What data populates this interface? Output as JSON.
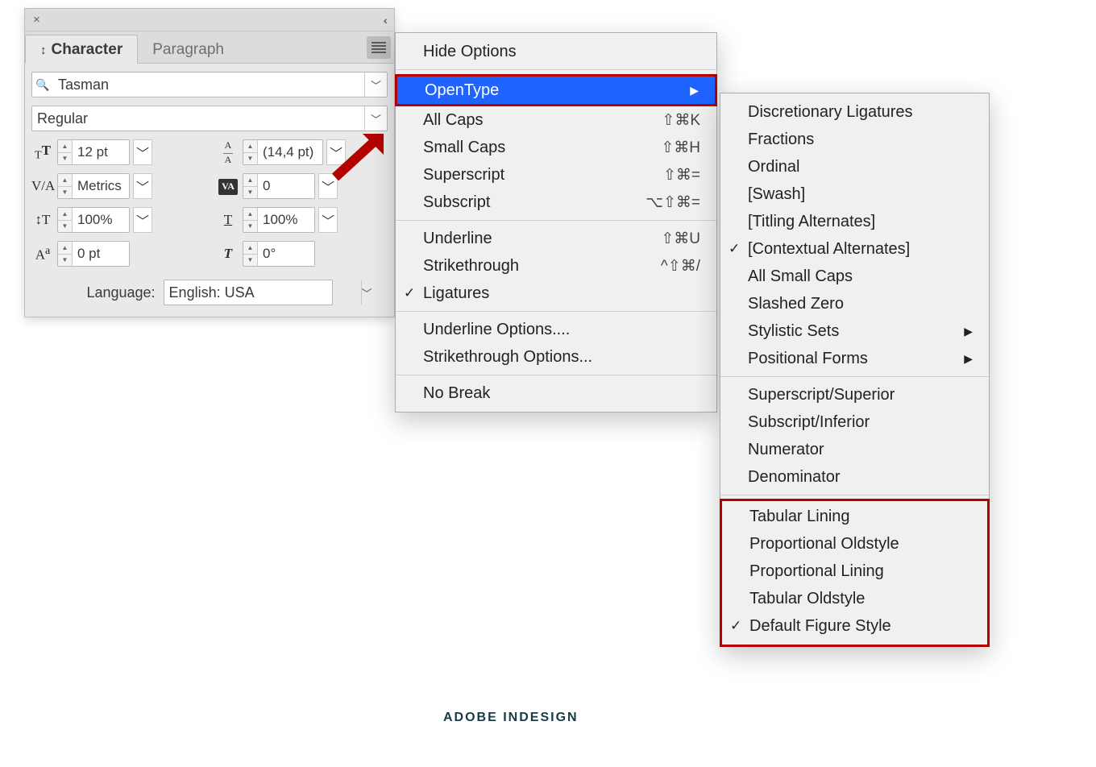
{
  "panel": {
    "tabs": {
      "character": "Character",
      "paragraph": "Paragraph"
    },
    "font_family": "Tasman",
    "font_style": "Regular",
    "font_size": "12 pt",
    "leading": "(14,4 pt)",
    "kerning": "Metrics",
    "tracking": "0",
    "vscale": "100%",
    "hscale": "100%",
    "baseline": "0 pt",
    "skew": "0°",
    "language_label": "Language:",
    "language_value": "English: USA"
  },
  "menu1": {
    "hide_options": "Hide Options",
    "opentype": "OpenType",
    "all_caps": {
      "label": "All Caps",
      "shortcut": "⇧⌘K"
    },
    "small_caps": {
      "label": "Small Caps",
      "shortcut": "⇧⌘H"
    },
    "superscript": {
      "label": "Superscript",
      "shortcut": "⇧⌘="
    },
    "subscript": {
      "label": "Subscript",
      "shortcut": "⌥⇧⌘="
    },
    "underline": {
      "label": "Underline",
      "shortcut": "⇧⌘U"
    },
    "strike": {
      "label": "Strikethrough",
      "shortcut": "^⇧⌘/"
    },
    "ligatures": "Ligatures",
    "und_opt": "Underline Options....",
    "str_opt": "Strikethrough Options...",
    "no_break": "No Break"
  },
  "menu2": {
    "disc_lig": "Discretionary Ligatures",
    "fractions": "Fractions",
    "ordinal": "Ordinal",
    "swash": "[Swash]",
    "titling": "[Titling Alternates]",
    "contextual": "[Contextual Alternates]",
    "all_small": "All Small Caps",
    "slashed": "Slashed Zero",
    "stylistic": "Stylistic Sets",
    "positional": "Positional Forms",
    "sup_sup": "Superscript/Superior",
    "sub_inf": "Subscript/Inferior",
    "numerator": "Numerator",
    "denominator": "Denominator",
    "tab_lining": "Tabular Lining",
    "prop_old": "Proportional Oldstyle",
    "prop_lin": "Proportional Lining",
    "tab_old": "Tabular Oldstyle",
    "default_fig": "Default Figure Style"
  },
  "caption": "ADOBE INDESIGN"
}
